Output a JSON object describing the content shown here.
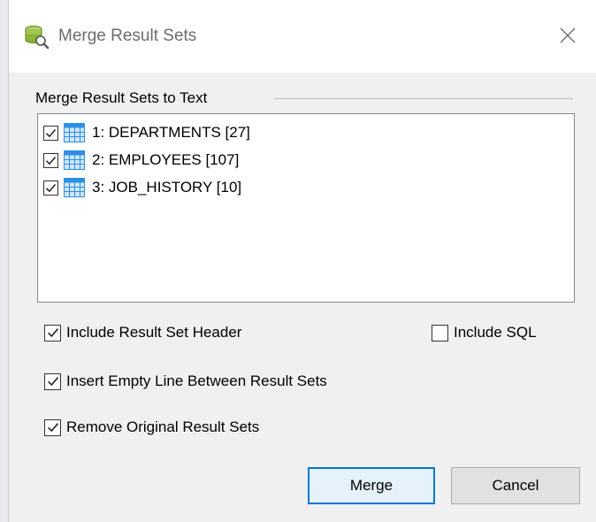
{
  "window": {
    "title": "Merge Result Sets"
  },
  "group": {
    "label": "Merge Result Sets to Text"
  },
  "result_sets": [
    {
      "label": "1: DEPARTMENTS [27]",
      "checked": true
    },
    {
      "label": "2: EMPLOYEES [107]",
      "checked": true
    },
    {
      "label": "3: JOB_HISTORY [10]",
      "checked": true
    }
  ],
  "options": {
    "include_header": {
      "label": "Include Result Set Header",
      "checked": true
    },
    "include_sql": {
      "label": "Include SQL",
      "checked": false
    },
    "insert_empty_line": {
      "label": "Insert Empty Line Between Result Sets",
      "checked": true
    },
    "remove_original": {
      "label": "Remove Original Result Sets",
      "checked": true
    }
  },
  "buttons": {
    "merge": "Merge",
    "cancel": "Cancel"
  },
  "colors": {
    "accent": "#0078d7",
    "grid_icon": "#2d8fe3",
    "db_icon": "#8ab33a"
  }
}
